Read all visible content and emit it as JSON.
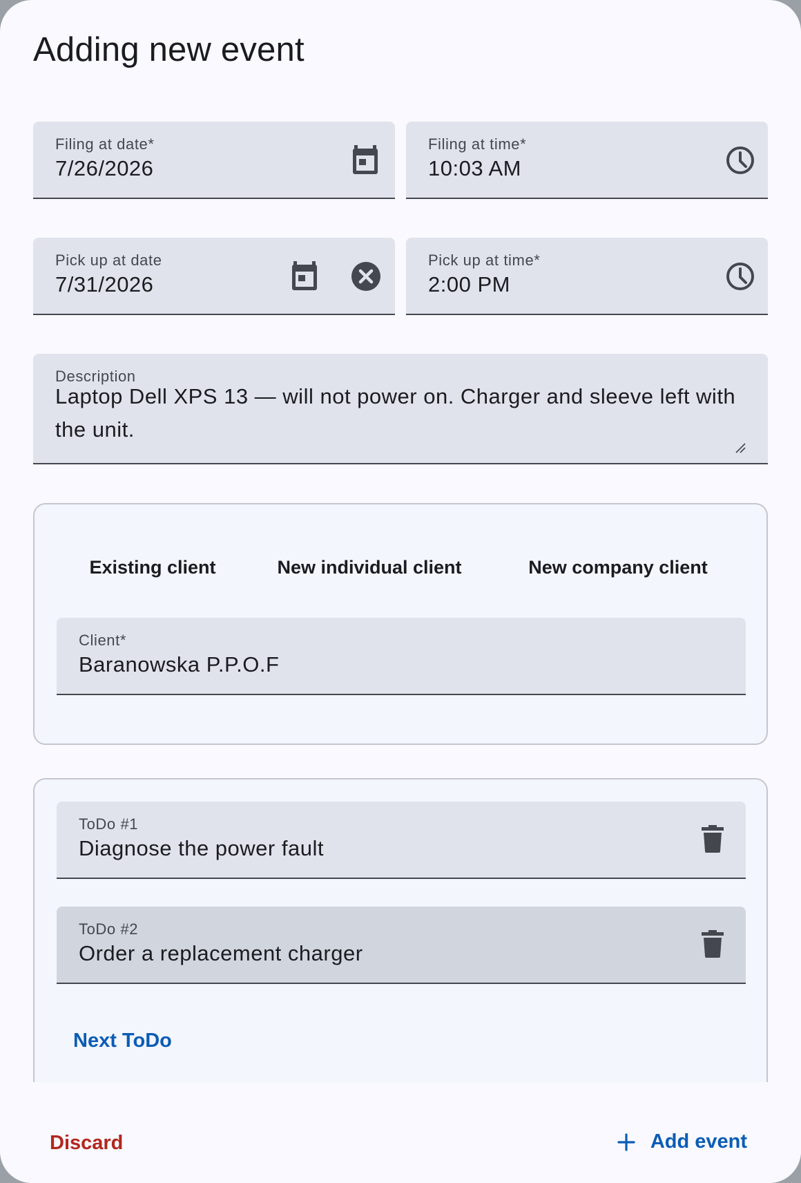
{
  "dialog": {
    "title": "Adding new event"
  },
  "filing_date": {
    "label": "Filing at date*",
    "value": "7/26/2026",
    "icon": "calendar-icon"
  },
  "filing_time": {
    "label": "Filing at time*",
    "value": "10:03 AM",
    "icon": "clock-icon"
  },
  "pickup_date": {
    "label": "Pick up at date",
    "value": "7/31/2026",
    "icon": "calendar-icon",
    "clear_icon": "cancel-circle-icon"
  },
  "pickup_time": {
    "label": "Pick up at time*",
    "value": "2:00 PM",
    "icon": "clock-icon"
  },
  "description": {
    "label": "Description",
    "value": "Laptop Dell XPS 13 — will not power on. Charger and sleeve left with the unit."
  },
  "client_tabs": {
    "tabs": [
      {
        "label": "Existing client",
        "selected": true
      },
      {
        "label": "New individual client",
        "selected": false
      },
      {
        "label": "New company client",
        "selected": false
      }
    ],
    "client_field": {
      "label": "Client*",
      "value": "Baranowska P.P.O.F"
    }
  },
  "todos": {
    "items": [
      {
        "label": "ToDo #1",
        "value": "Diagnose the power fault",
        "icon": "delete-icon"
      },
      {
        "label": "ToDo #2",
        "value": "Order a replacement charger",
        "icon": "delete-icon"
      }
    ],
    "next_label": "Next ToDo"
  },
  "footer": {
    "discard_label": "Discard",
    "add_label": "Add event",
    "add_icon": "plus-icon"
  },
  "colors": {
    "primary": "#0b5cb5",
    "error": "#b3261e",
    "surface": "#f9f9ff",
    "field_fill": "#e0e3eb"
  }
}
